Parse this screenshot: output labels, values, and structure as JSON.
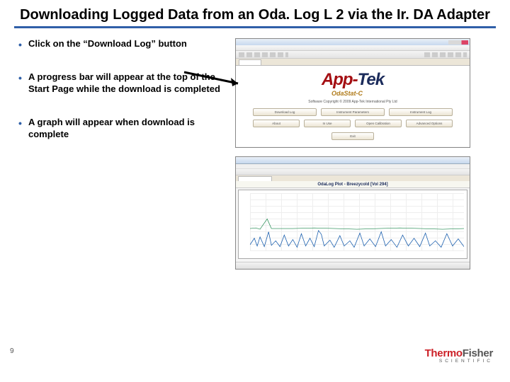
{
  "title": "Downloading Logged Data from an Oda. Log L 2 via the Ir. DA Adapter",
  "bullets": [
    "Click on the “Download Log” button",
    "A progress bar will appear at the top of the Start Page while the download is completed",
    "A graph will appear when download is complete"
  ],
  "screenshot1": {
    "logo_app": "App",
    "logo_dash": "-",
    "logo_tek": "Tek",
    "sublogo": "OdaStat-C",
    "tagline": "Software Copyright © 2009 App-Tek International Pty Ltd",
    "buttons_row1": [
      "Download Log",
      "Instrument Parameters",
      "Instrument Log"
    ],
    "buttons_row2": [
      "About",
      "In Use",
      "Open Calibration",
      "Advanced Options"
    ],
    "buttons_row3": [
      "Exit"
    ]
  },
  "screenshot2": {
    "graph_title": "OdaLog Plot - Breezycold [Vol 294]"
  },
  "page_number": "9",
  "brand": {
    "part1": "Thermo",
    "part2": "Fisher",
    "sub": "SCIENTIFIC"
  }
}
